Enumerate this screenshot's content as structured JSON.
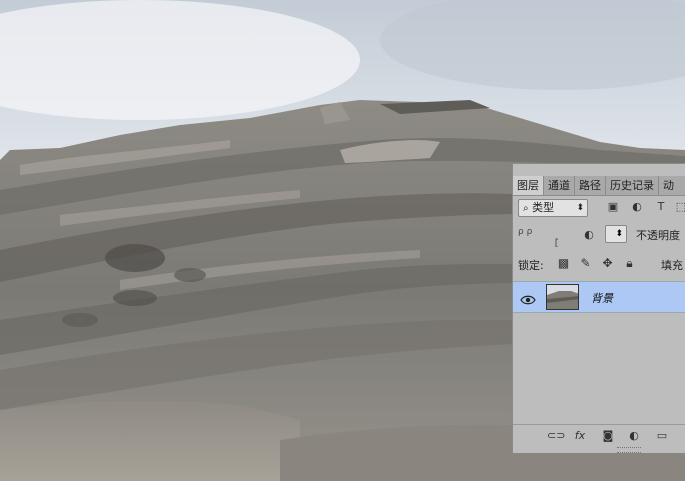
{
  "layers_panel": {
    "tabs": [
      "图层",
      "通道",
      "路径",
      "历史记录",
      "动"
    ],
    "active_tab": "图层",
    "filter": {
      "kind_label": "类型",
      "icons": [
        "search-icon",
        "image-filter-icon",
        "adjustment-filter-icon",
        "type-filter-icon",
        "shape-filter-icon"
      ]
    },
    "opacity_label": "不透明度",
    "lock_label": "锁定:",
    "lock_icons": [
      "lock-transparent-icon",
      "lock-paint-icon",
      "lock-move-icon",
      "lock-all-icon"
    ],
    "fill_label": "填充",
    "layers": [
      {
        "name": "背景",
        "visible": true,
        "selected": true
      }
    ],
    "bottom_icons": [
      "link-layers-icon",
      "fx-icon",
      "mask-icon",
      "adjustment-layer-icon",
      "new-group-icon"
    ]
  },
  "colors": {
    "panel_bg": "#bdbdbd",
    "tab_bar": "#a9a9a9",
    "selected_layer": "#adc8f4"
  }
}
